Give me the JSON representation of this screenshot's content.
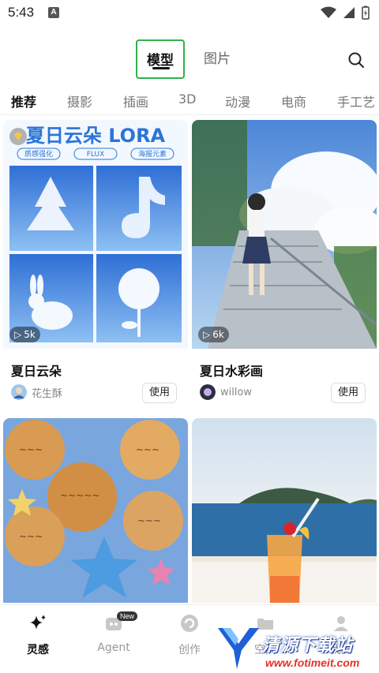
{
  "status_bar": {
    "time": "5:43",
    "app_icon": "A"
  },
  "top_tabs": [
    {
      "label": "模型",
      "active": true
    },
    {
      "label": "图片",
      "active": false
    }
  ],
  "categories": [
    "推荐",
    "摄影",
    "插画",
    "3D",
    "动漫",
    "电商",
    "手工艺"
  ],
  "cards": [
    {
      "title": "夏日云朵",
      "author": "花生酥",
      "views": "5k",
      "use_label": "使用",
      "banner_title": "夏日云朵 LORA",
      "tags": [
        "质感强化",
        "FLUX",
        "海报元素"
      ]
    },
    {
      "title": "夏日水彩画",
      "author": "willow",
      "views": "6k",
      "use_label": "使用"
    },
    {
      "title": "",
      "author": "",
      "views": "",
      "use_label": ""
    },
    {
      "title": "",
      "author": "",
      "views": "",
      "use_label": ""
    }
  ],
  "bottom_nav": [
    {
      "label": "灵感",
      "icon": "sparkle-icon",
      "active": true
    },
    {
      "label": "Agent",
      "icon": "agent-icon",
      "badge": "New",
      "active": false
    },
    {
      "label": "创作",
      "icon": "create-icon",
      "active": false
    },
    {
      "label": "空间",
      "icon": "folder-icon",
      "active": false
    },
    {
      "label": "我的",
      "icon": "profile-icon",
      "active": false
    }
  ],
  "watermark": {
    "title": "清源下载站",
    "url": "www.fotimeit.com"
  },
  "colors": {
    "highlight": "#2fb24a",
    "accent": "#111111"
  }
}
